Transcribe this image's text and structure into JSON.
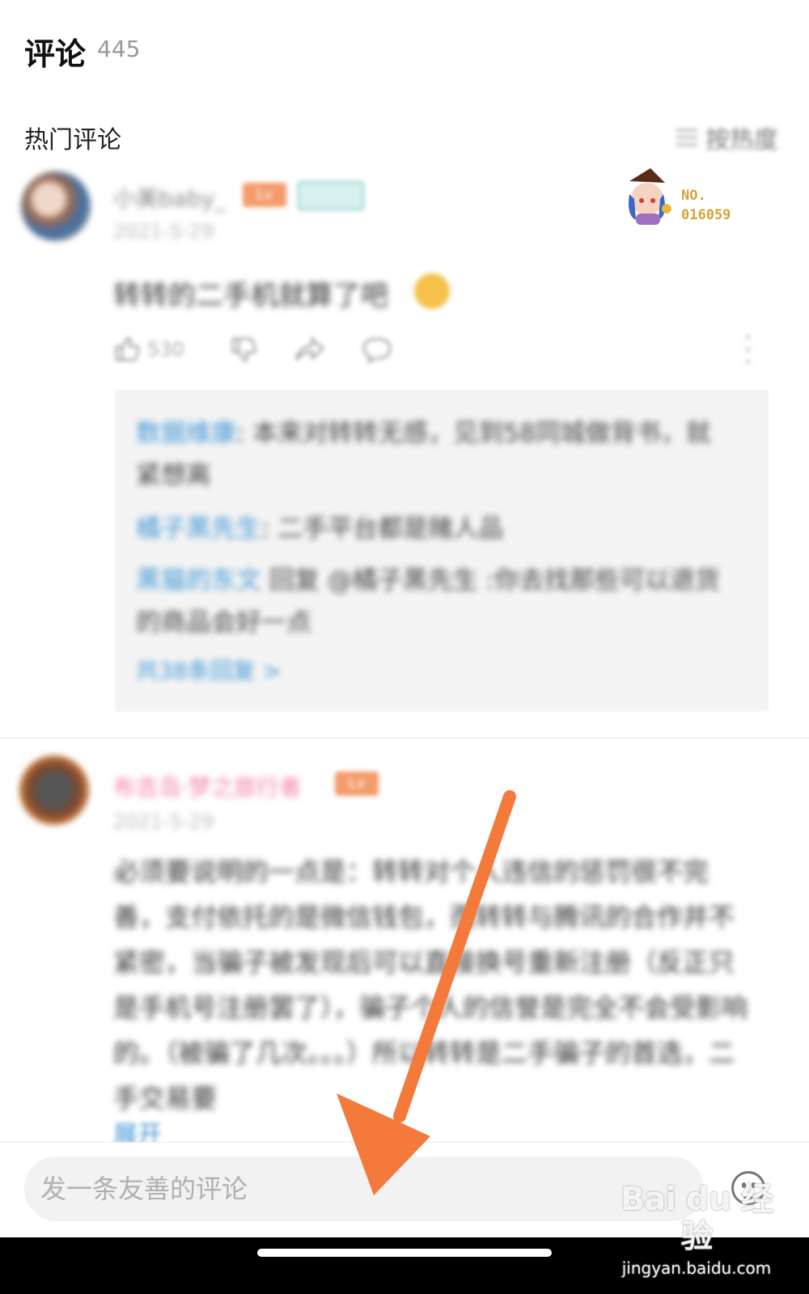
{
  "header": {
    "title": "评论",
    "count": "445"
  },
  "hot_section": {
    "title": "热门评论",
    "sort_label": "按热度"
  },
  "comment1": {
    "username": "小美baby_",
    "tag_level": "Lv",
    "date": "2021-5-29",
    "badge_no": "NO.",
    "badge_number": "016059",
    "text": "转转的二手机就算了吧",
    "likes": "530",
    "replies": [
      {
        "user": "数据维康",
        "text": ": 本来对转转无感，见到58同城做背书，就紧想离"
      },
      {
        "user": "橘子黑先生",
        "text": ": 二手平台都是赌人品"
      },
      {
        "user": "黑猫的东文",
        "text": " 回复 @橘子黑先生 :你去找那些可以退货的商品会好一点"
      }
    ],
    "more_replies": "共38条回复 >"
  },
  "comment2": {
    "username": "布吉岛·梦之旅行者",
    "tag_level": "Lv",
    "date": "2021-5-29",
    "text": "必须要说明的一点是：转转对个人违信的惩罚很不完善，支付依托的是微信钱包，而转转与腾讯的合作并不紧密，当骗子被发现后可以直接换号重新注册（反正只是手机号注册罢了），骗子个人的信誉是完全不会受影响的。（被骗了几次。。。）所以转转是二手骗子的首选，二手交易要",
    "expand": "展开"
  },
  "input": {
    "placeholder": "发一条友善的评论"
  },
  "watermark": {
    "logo": "Bai du 经验",
    "url": "jingyan.baidu.com"
  },
  "colors": {
    "link": "#3f96d6",
    "arrow": "#f47a3c",
    "pink_name": "#f07aa8",
    "tag": "#f39b6a"
  }
}
